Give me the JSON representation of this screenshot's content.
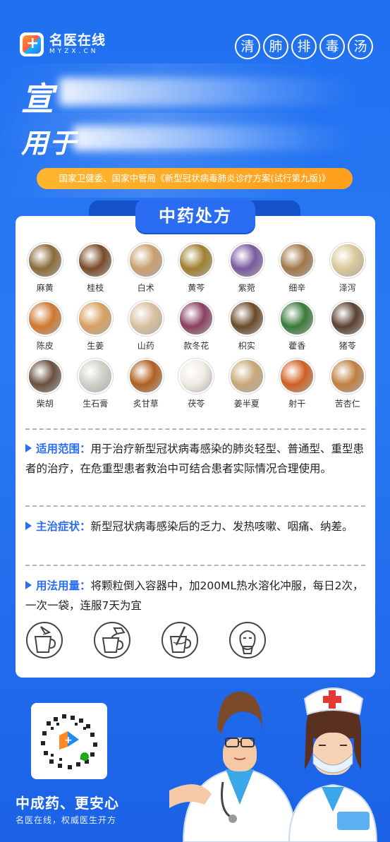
{
  "brand": {
    "name": "名医在线",
    "domain": "MYZX.CN"
  },
  "title_chars": [
    "清",
    "肺",
    "排",
    "毒",
    "汤"
  ],
  "headline": {
    "line1": "宣",
    "line2": "用于"
  },
  "source": "国家卫健委、国家中管局《新型冠状病毒肺炎诊疗方案(试行第九版)》",
  "card": {
    "tab_title": "中药处方",
    "herbs": [
      {
        "name": "麻黄",
        "color": "#8a6a3a"
      },
      {
        "name": "桂枝",
        "color": "#7a4a2a"
      },
      {
        "name": "白术",
        "color": "#c8a070"
      },
      {
        "name": "黄芩",
        "color": "#a08030"
      },
      {
        "name": "紫菀",
        "color": "#7a5aa0"
      },
      {
        "name": "细辛",
        "color": "#a07848"
      },
      {
        "name": "泽泻",
        "color": "#d8c898"
      },
      {
        "name": "陈皮",
        "color": "#d07830"
      },
      {
        "name": "生姜",
        "color": "#d8a060"
      },
      {
        "name": "山药",
        "color": "#d8c0a0"
      },
      {
        "name": "款冬花",
        "color": "#8a4060"
      },
      {
        "name": "枳实",
        "color": "#6a4a2a"
      },
      {
        "name": "藿香",
        "color": "#3a7a3a"
      },
      {
        "name": "猪苓",
        "color": "#5a4030"
      },
      {
        "name": "柴胡",
        "color": "#6a5040"
      },
      {
        "name": "生石膏",
        "color": "#d0d0c8"
      },
      {
        "name": "炙甘草",
        "color": "#b06020"
      },
      {
        "name": "茯苓",
        "color": "#f0ece4"
      },
      {
        "name": "姜半夏",
        "color": "#c8a878"
      },
      {
        "name": "射干",
        "color": "#d06020"
      },
      {
        "name": "苦杏仁",
        "color": "#c08040"
      }
    ],
    "sections": {
      "scope": {
        "label": "适用范围：",
        "text": "用于治疗新型冠状病毒感染的肺炎轻型、普通型、重型患者的治疗，在危重型患者救治中可结合患者实际情况合理使用。"
      },
      "symptoms": {
        "label": "主治症状：",
        "text": "新型冠状病毒感染后的乏力、发热咳嗽、咽痛、纳差。"
      },
      "usage": {
        "label": "用法用量：",
        "text": "将颗粒倒入容器中，加200ML热水溶化冲服，每日2次，一次一袋，连服7天为宜"
      }
    }
  },
  "footer": {
    "slogan": "中成药、更安心",
    "sub_slogan": "名医在线，权威医生开方"
  },
  "colors": {
    "background": "#1f6ff0",
    "accent": "#2b6df2",
    "pill": "#ffb52e"
  }
}
